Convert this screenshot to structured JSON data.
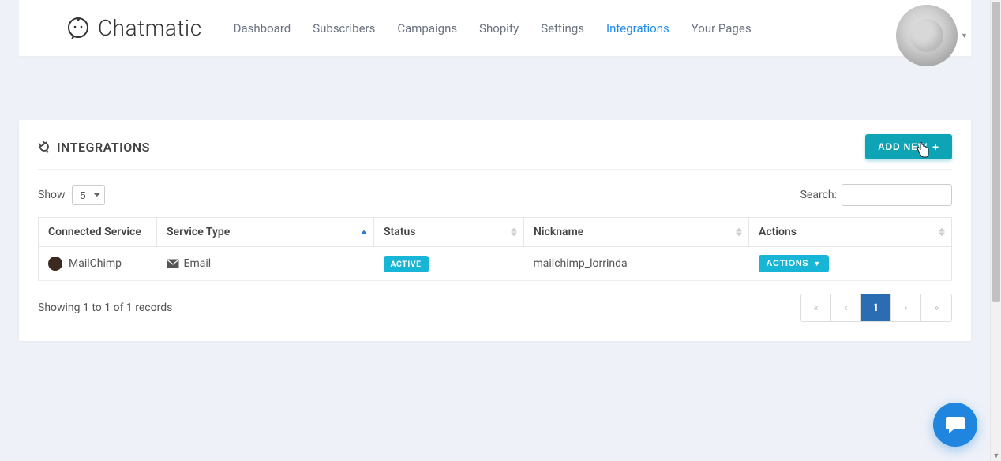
{
  "brand": "Chatmatic",
  "nav": {
    "items": [
      {
        "label": "Dashboard"
      },
      {
        "label": "Subscribers"
      },
      {
        "label": "Campaigns"
      },
      {
        "label": "Shopify"
      },
      {
        "label": "Settings"
      },
      {
        "label": "Integrations",
        "active": true
      },
      {
        "label": "Your Pages"
      }
    ]
  },
  "page": {
    "title": "INTEGRATIONS",
    "add_new_label": "ADD NEW"
  },
  "controls": {
    "show_label": "Show",
    "page_size_selected": "5",
    "page_size_options": [
      "5"
    ],
    "search_label": "Search:",
    "search_value": ""
  },
  "table": {
    "columns": [
      {
        "label": "Connected Service",
        "sort": "none"
      },
      {
        "label": "Service Type",
        "sort": "asc"
      },
      {
        "label": "Status",
        "sort": "both"
      },
      {
        "label": "Nickname",
        "sort": "both"
      },
      {
        "label": "Actions",
        "sort": "both"
      }
    ],
    "rows": [
      {
        "service": "MailChimp",
        "type": "Email",
        "status": "ACTIVE",
        "nickname": "mailchimp_lorrinda",
        "actions_label": "ACTIONS"
      }
    ]
  },
  "footer": {
    "info": "Showing 1 to 1 of 1 records",
    "current_page": "1"
  },
  "colors": {
    "accent_teal": "#0ea3b5",
    "badge_blue": "#18b6d6",
    "nav_active": "#1f8ded",
    "page_active": "#2a6db3",
    "chat_bubble": "#1f85de"
  }
}
